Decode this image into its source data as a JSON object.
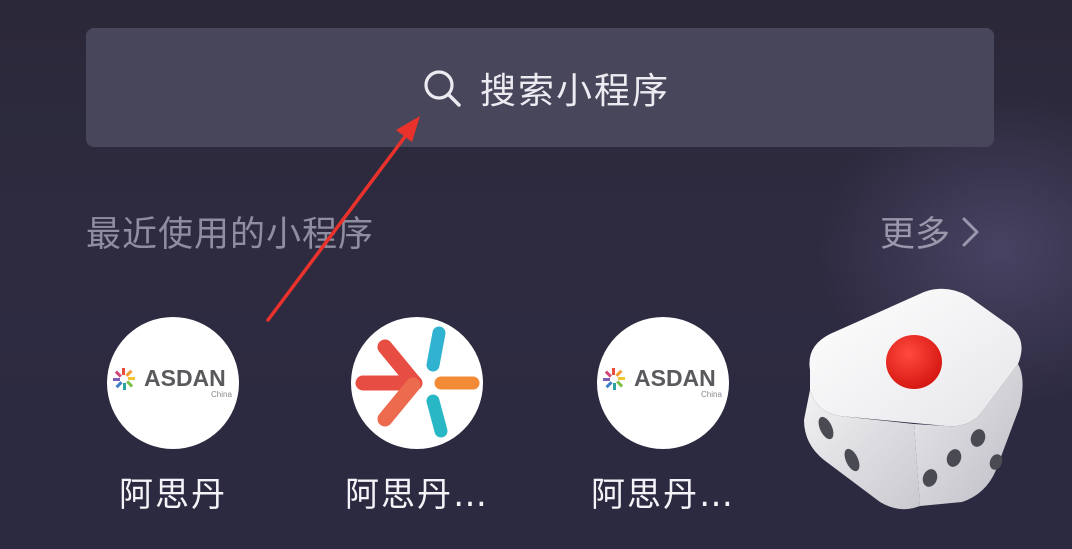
{
  "search": {
    "placeholder_text": "搜索小程序",
    "icon": "search-icon"
  },
  "recent": {
    "title": "最近使用的小程序",
    "more_label": "更多",
    "more_icon": "chevron-right-icon",
    "apps": [
      {
        "label": "阿思丹",
        "icon": "asdan-logo-icon"
      },
      {
        "label": "阿思丹…",
        "icon": "arrow-burst-logo-icon"
      },
      {
        "label": "阿思丹…",
        "icon": "asdan-logo-icon"
      }
    ]
  },
  "logos": {
    "asdan_wordmark": "ASDAN",
    "asdan_sub": "China"
  },
  "floating": {
    "icon": "dice-icon"
  },
  "annotation": {
    "icon": "red-arrow-icon",
    "color": "#e8322b"
  },
  "colors": {
    "background": "#2c2a3e",
    "search_bar": "#48465a",
    "section_title": "#8f8da0",
    "label_text": "#f4f3f8",
    "dice_pip": "#e8211d"
  }
}
